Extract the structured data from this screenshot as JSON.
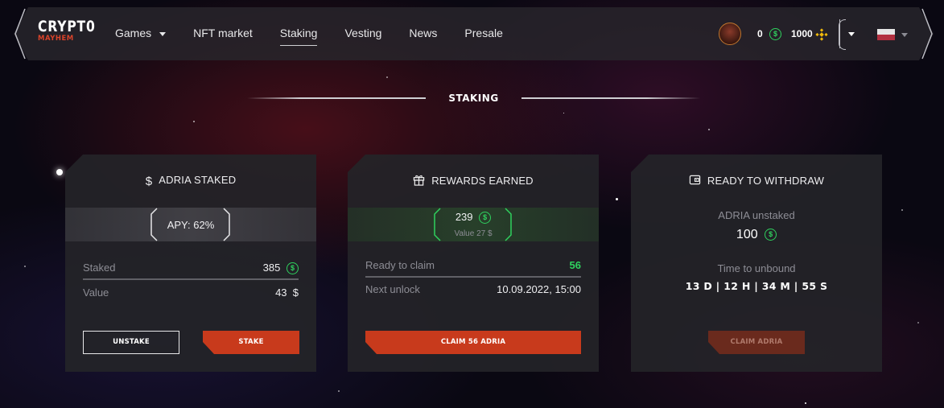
{
  "header": {
    "logo_line1": "CRYPT0",
    "logo_line2": "MAYHEM",
    "menu": [
      {
        "label": "Games"
      },
      {
        "label": "NFT market"
      },
      {
        "label": "Staking"
      },
      {
        "label": "Vesting"
      },
      {
        "label": "News"
      },
      {
        "label": "Presale"
      }
    ],
    "active_menu": "Staking",
    "balance_adria": "0",
    "balance_bnb": "1000",
    "coin_symbol": "$"
  },
  "page": {
    "title": "STAKING"
  },
  "staked_card": {
    "heading": "ADRIA STAKED",
    "apy": "APY: 62%",
    "rows": [
      {
        "label": "Staked",
        "value": "385"
      },
      {
        "label": "Value",
        "value": "43  $"
      }
    ],
    "unstake_label": "UNSTAKE",
    "stake_label": "STAKE"
  },
  "rewards_card": {
    "heading": "REWARDS EARNED",
    "earned": "239",
    "earned_value": "Value 27 $",
    "rows": [
      {
        "label": "Ready to claim",
        "value": "56"
      },
      {
        "label": "Next unlock",
        "value": "10.09.2022, 15:00"
      }
    ],
    "claim_label": "CLAIM 56 ADRIA"
  },
  "withdraw_card": {
    "heading": "READY TO WITHDRAW",
    "unstaked_label": "ADRIA unstaked",
    "unstaked_value": "100",
    "unbound_label": "Time to unbound",
    "timer": "13 D | 12 H | 34 M | 55 S",
    "claim_label": "CLAIM ADRIA"
  },
  "colors": {
    "accent_red": "#c83a1c",
    "coin_green": "#2fd15e",
    "bnb_yellow": "#f0b90b"
  },
  "icons": [
    "dollar-icon",
    "gift-icon",
    "wallet-icon",
    "adria-coin-icon",
    "bnb-coin-icon",
    "chevron-down-icon"
  ]
}
